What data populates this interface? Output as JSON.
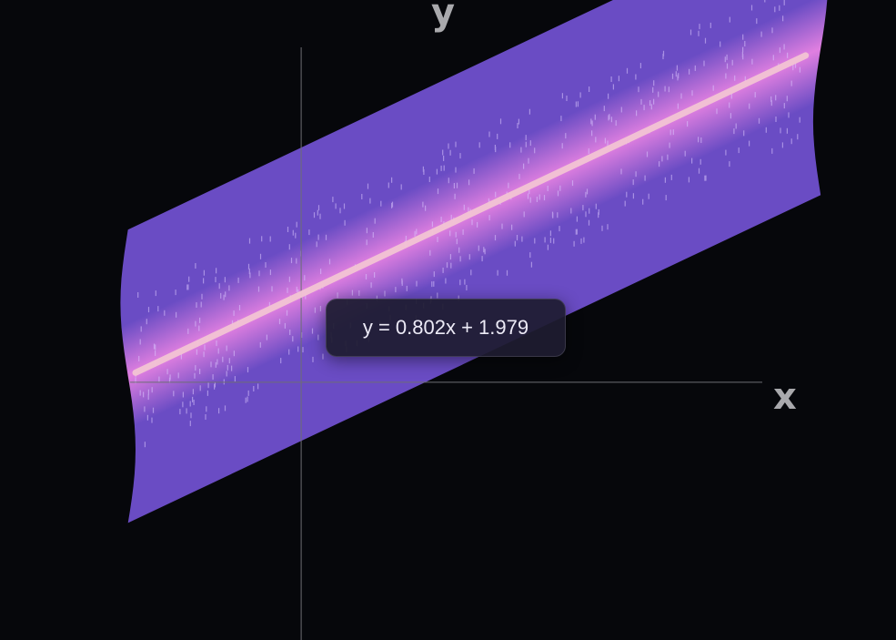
{
  "x_axis_label": "x",
  "y_axis_label": "y",
  "tooltip": {
    "equation": "y = 0.802x + 1.979"
  },
  "colors": {
    "background": "#06070b",
    "axis_line": "#6e6e74",
    "axis_label": "#a9a9ad",
    "band_edge": "#6a4cc4",
    "band_center": "#e07fe0",
    "regression_line": "#f3c4d4",
    "scatter_points": "#dcc8ff"
  },
  "chart_data": {
    "type": "scatter",
    "title": "",
    "xlabel": "x",
    "ylabel": "y",
    "grid": false,
    "xlim": [
      -4.0,
      7.9
    ],
    "ylim": [
      -5.8,
      8.6
    ],
    "regression": {
      "slope": 0.802,
      "intercept": 1.979,
      "x_range": [
        -2.2,
        6.7
      ]
    },
    "band_x_range": [
      -2.3,
      6.9
    ],
    "band_half_width": 3.3,
    "point_x_range": [
      -2.2,
      6.7
    ],
    "point_spread": 1.8,
    "point_count": 520
  }
}
